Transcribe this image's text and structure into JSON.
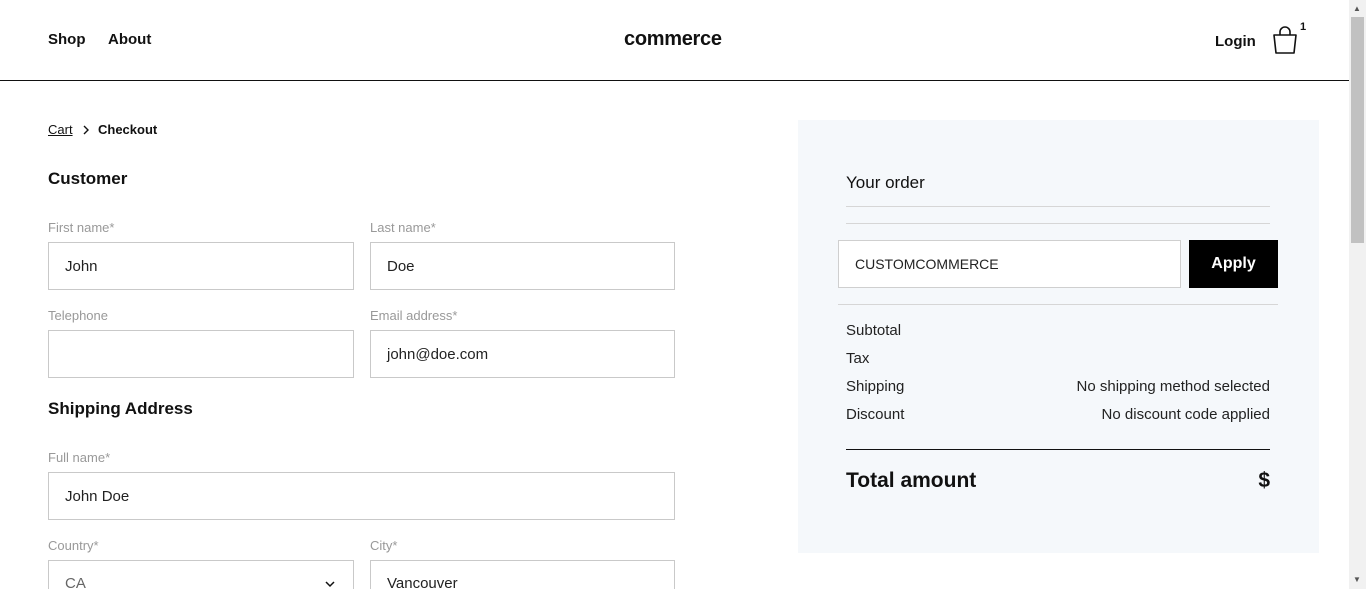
{
  "header": {
    "nav": [
      "Shop",
      "About"
    ],
    "logo": "commerce",
    "login": "Login",
    "cart_count": "1"
  },
  "breadcrumb": {
    "cart": "Cart",
    "current": "Checkout"
  },
  "customer": {
    "title": "Customer",
    "first_name": {
      "label": "First name*",
      "value": "John"
    },
    "last_name": {
      "label": "Last name*",
      "value": "Doe"
    },
    "telephone": {
      "label": "Telephone",
      "value": ""
    },
    "email": {
      "label": "Email address*",
      "value": "john@doe.com"
    }
  },
  "shipping": {
    "title": "Shipping Address",
    "full_name": {
      "label": "Full name*",
      "value": "John Doe"
    },
    "country": {
      "label": "Country*",
      "value": "CA"
    },
    "city": {
      "label": "City*",
      "value": "Vancouver"
    }
  },
  "order": {
    "title": "Your order",
    "discount_code": "CUSTOMCOMMERCE",
    "apply_label": "Apply",
    "subtotal_label": "Subtotal",
    "tax_label": "Tax",
    "shipping_label": "Shipping",
    "shipping_value": "No shipping method selected",
    "discount_label": "Discount",
    "discount_value": "No discount code applied",
    "total_label": "Total amount",
    "total_value": "$"
  }
}
